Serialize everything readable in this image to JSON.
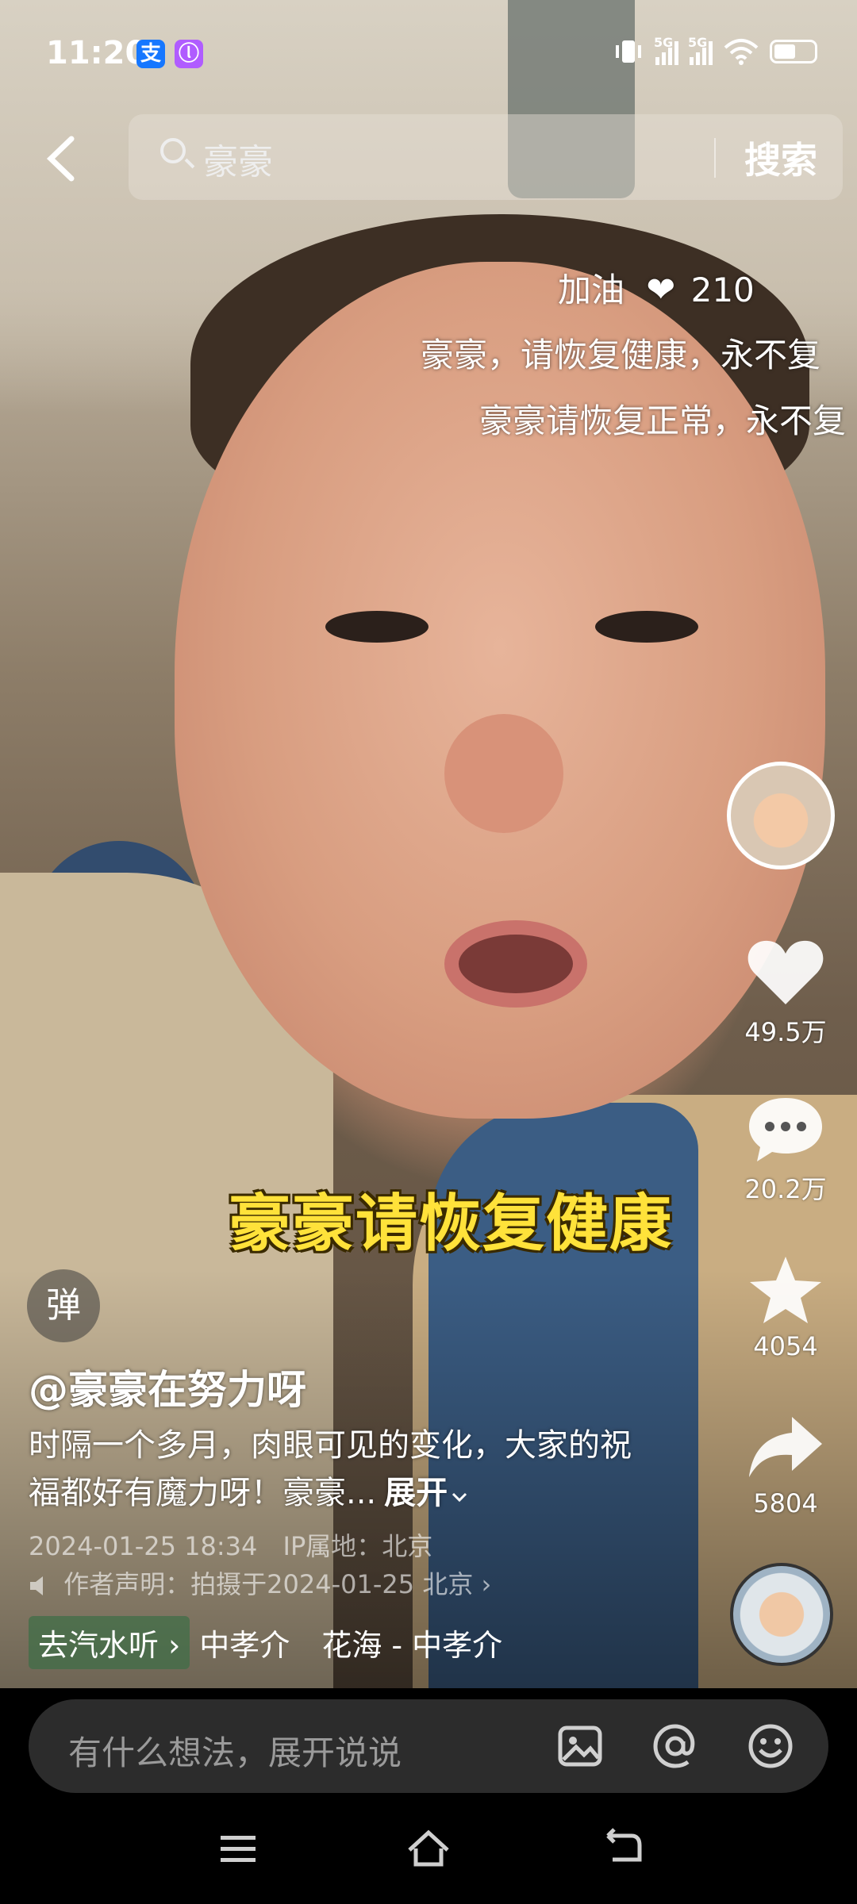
{
  "status_bar": {
    "time": "11:20",
    "app_icons": [
      "支",
      "ⓛ"
    ],
    "network": [
      "5G",
      "5G"
    ]
  },
  "search": {
    "query": "豪豪",
    "button": "搜索"
  },
  "danmaku": {
    "top": {
      "text": "加油",
      "likes": "210"
    },
    "line2": "豪豪，请恢复健康，永不复",
    "line3": "豪豪请恢复正常，永不复"
  },
  "caption": "豪豪请恢复健康",
  "actions": {
    "likes": "49.5万",
    "comments": "20.2万",
    "favorites": "4054",
    "shares": "5804"
  },
  "danmaku_toggle": "弹",
  "post": {
    "author": "@豪豪在努力呀",
    "description": "时隔一个多月，肉眼可见的变化，大家的祝福都好有魔力呀！豪豪...",
    "expand": "展开",
    "date": "2024-01-25 18:34",
    "ip": "IP属地：北京",
    "statement": "作者声明：拍摄于2024-01-25 北京"
  },
  "music": {
    "tag": "去汽水听",
    "artist": "中孝介",
    "song": "花海 - 中孝介"
  },
  "comment_input": {
    "placeholder": "有什么想法，展开说说"
  },
  "colors": {
    "caption_yellow": "#ffe23a",
    "background": "#000000"
  }
}
